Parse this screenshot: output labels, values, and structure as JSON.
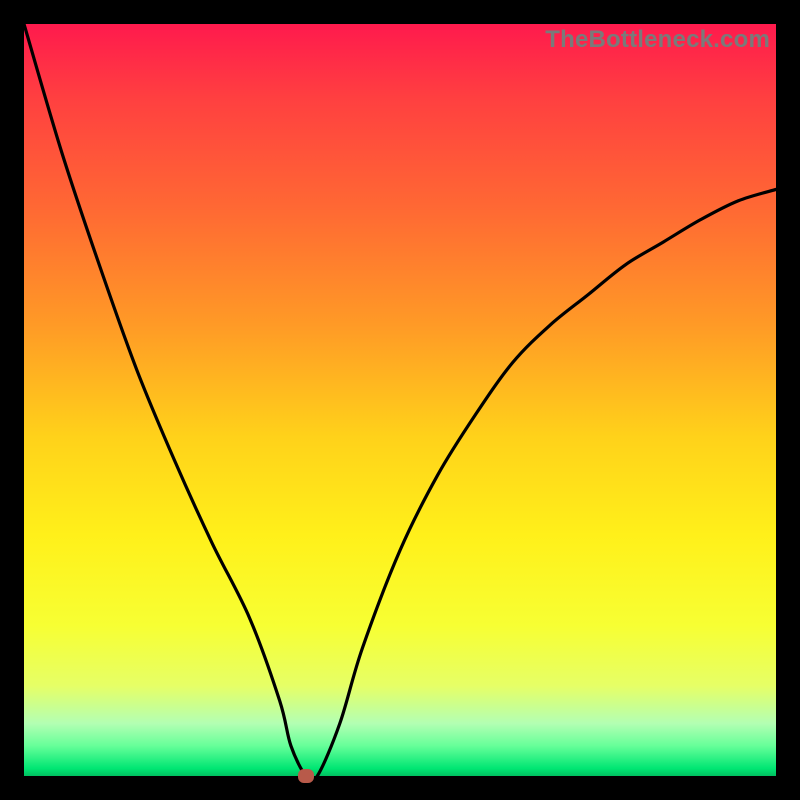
{
  "watermark": "TheBottleneck.com",
  "colors": {
    "frame_bg": "#000000",
    "watermark": "#7a7a7a",
    "curve": "#000000",
    "dot": "#b85a4a",
    "gradient_stops": [
      {
        "pct": 0,
        "hex": "#ff1a4d"
      },
      {
        "pct": 10,
        "hex": "#ff4040"
      },
      {
        "pct": 25,
        "hex": "#ff6a33"
      },
      {
        "pct": 40,
        "hex": "#ff9a26"
      },
      {
        "pct": 55,
        "hex": "#ffd21a"
      },
      {
        "pct": 68,
        "hex": "#fff01a"
      },
      {
        "pct": 80,
        "hex": "#f7ff33"
      },
      {
        "pct": 88,
        "hex": "#e6ff66"
      },
      {
        "pct": 93,
        "hex": "#b3ffb3"
      },
      {
        "pct": 96,
        "hex": "#66ff99"
      },
      {
        "pct": 99,
        "hex": "#00e673"
      },
      {
        "pct": 100,
        "hex": "#00c060"
      }
    ]
  },
  "chart_data": {
    "type": "line",
    "title": "",
    "xlabel": "",
    "ylabel": "",
    "xlim": [
      0,
      100
    ],
    "ylim": [
      0,
      100
    ],
    "note": "V-shaped bottleneck curve with minimum near x≈37.5; background gradient encodes severity (red=high, green=low). A small marker sits at the curve minimum on the baseline.",
    "series": [
      {
        "name": "bottleneck-curve",
        "x": [
          0,
          5,
          10,
          15,
          20,
          25,
          30,
          34,
          35.5,
          37.5,
          39,
          42,
          45,
          50,
          55,
          60,
          65,
          70,
          75,
          80,
          85,
          90,
          95,
          100
        ],
        "y": [
          100,
          83,
          68,
          54,
          42,
          31,
          21,
          10,
          4,
          0,
          0,
          7,
          17,
          30,
          40,
          48,
          55,
          60,
          64,
          68,
          71,
          74,
          76.5,
          78
        ]
      }
    ],
    "marker": {
      "x": 37.5,
      "y": 0
    }
  }
}
